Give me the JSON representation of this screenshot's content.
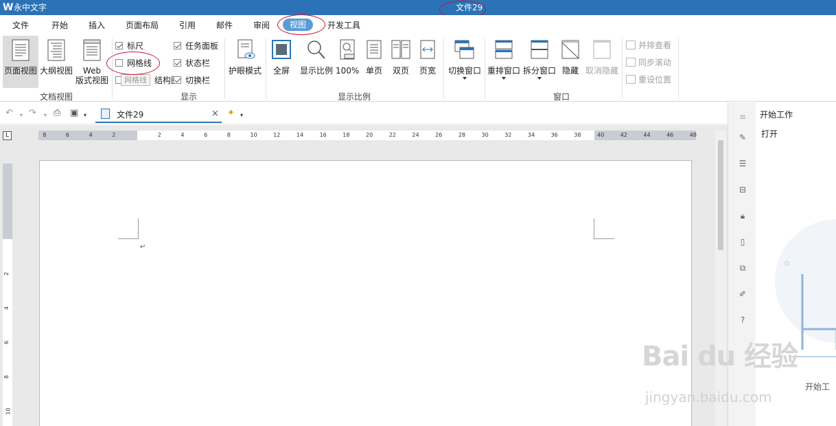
{
  "app": {
    "name": "永中文字",
    "doc_title": "文件29"
  },
  "menu": {
    "tabs": [
      {
        "label": "文件"
      },
      {
        "label": "开始"
      },
      {
        "label": "插入"
      },
      {
        "label": "页面布局"
      },
      {
        "label": "引用"
      },
      {
        "label": "邮件"
      },
      {
        "label": "审阅"
      },
      {
        "label": "视图"
      },
      {
        "label": "开发工具"
      }
    ],
    "active": "视图"
  },
  "ribbon": {
    "doc_view": {
      "page_view": "页面视图",
      "outline_view": "大纲视图",
      "web_view_1": "Web",
      "web_view_2": "版式视图",
      "label": "文档视图"
    },
    "show": {
      "ruler": "标尺",
      "grid": "网格线",
      "tooltip": "网格线",
      "doc_structure": "结构图",
      "task_pane": "任务面板",
      "status_bar": "状态栏",
      "switch_bar": "切换栏",
      "label": "显示",
      "ruler_checked": true,
      "grid_checked": false,
      "task_pane_checked": true,
      "status_checked": true,
      "switch_checked": true
    },
    "eye_mode": "护眼模式",
    "zoom": {
      "fullscreen": "全屏",
      "zoom": "显示比例",
      "hundred": "100%",
      "single": "单页",
      "double": "双页",
      "width": "页宽",
      "label": "显示比例"
    },
    "window": {
      "switch": "切换窗口",
      "rearrange": "重排窗口",
      "split": "拆分窗口",
      "hide": "隐藏",
      "unhide": "取消隐藏",
      "side_by_side": "并排查看",
      "sync_scroll": "同步滚动",
      "reset_pos": "重设位置",
      "label": "窗口"
    }
  },
  "doc_tab": {
    "label": "文件29"
  },
  "ruler": {
    "h_left": [
      "8",
      "6",
      "4",
      "2"
    ],
    "h_right": [
      "2",
      "4",
      "6",
      "8",
      "10",
      "12",
      "14",
      "16",
      "18",
      "20",
      "22",
      "24",
      "26",
      "28",
      "30",
      "32",
      "34",
      "36",
      "38",
      "40",
      "42",
      "44",
      "46",
      "48"
    ],
    "v": [
      "2",
      "4",
      "6",
      "8",
      "10"
    ]
  },
  "right_pane": {
    "title": "开始工作",
    "open": "打开",
    "footer": "开始工"
  },
  "watermark": {
    "main": "Bai du 经验",
    "sub": "jingyan.baidu.com"
  },
  "colors": {
    "title_bar": "#2b73b6",
    "active_tab": "#5b9bd5",
    "annotation": "#c8102e"
  }
}
